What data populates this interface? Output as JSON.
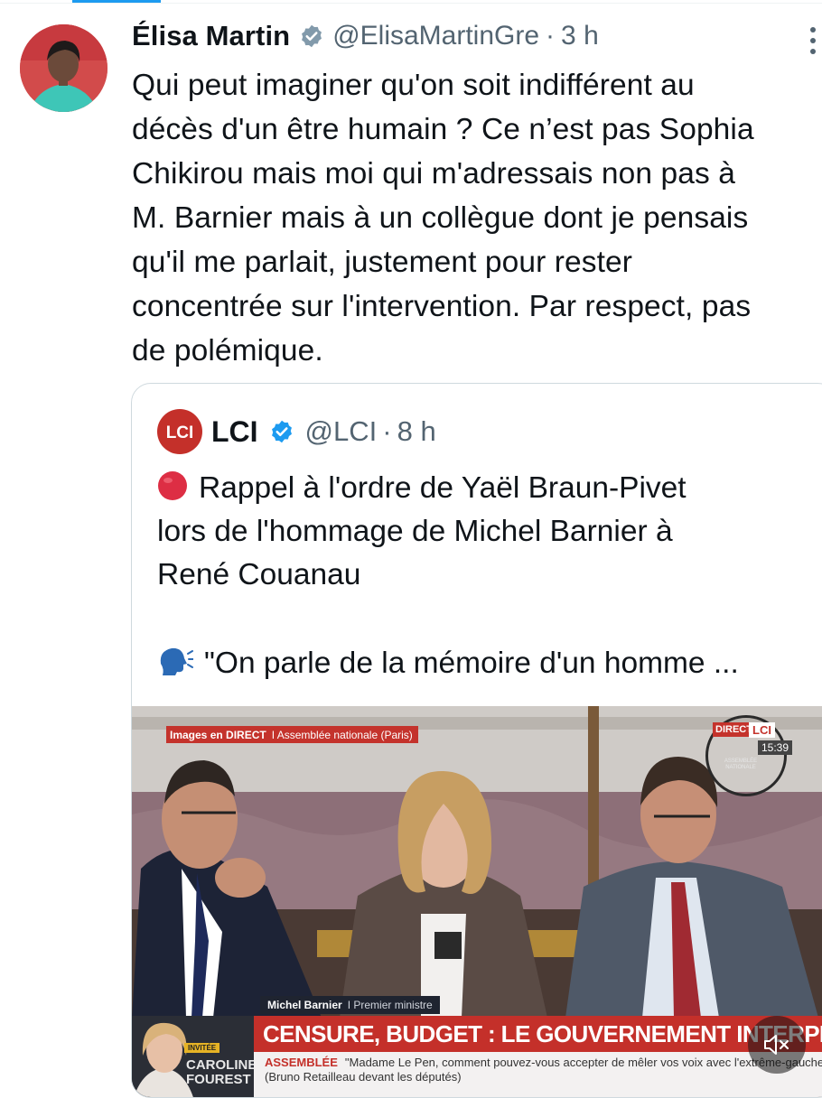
{
  "tweet": {
    "author_name": "Élisa Martin",
    "handle": "@ElisaMartinGre",
    "separator": "·",
    "time": "3 h",
    "text": "Qui peut imaginer qu'on soit indifférent au\ndécès d'un être humain ? Ce n’est pas Sophia\nChikirou mais moi qui m'adressais non pas à\nM. Barnier mais à un collègue dont je pensais\nqu'il me parlait, justement pour rester\nconcentrée sur l'intervention. Par respect, pas\nde polémique."
  },
  "quote": {
    "author_name": "LCI",
    "handle": "@LCI",
    "separator": "·",
    "time": "8 h",
    "line1": "Rappel à l'ordre de Yaël Braun-Pivet",
    "line2": "lors de l'hommage de Michel Barnier à",
    "line3": "René Couanau",
    "line4": "\"On parle de la mémoire d'un homme ...",
    "emoji1": "red-circle",
    "emoji2": "speaking-head"
  },
  "video": {
    "direct_tag_bold": "Images en DIRECT",
    "direct_tag_place": "I  Assemblée nationale (Paris)",
    "bug_direct": "DIRECT",
    "bug_lci": "LCI",
    "bug_time": "15:39",
    "bug_assembly": "ASSEMBLÉE NATIONALE",
    "lower_name": "Michel Barnier",
    "lower_role": "I  Premier ministre",
    "banner": "CENSURE, BUDGET : LE GOUVERNEMENT INTERPELLÉ",
    "ticker_tag": "ASSEMBLÉE",
    "ticker_text": "\"Madame Le Pen, comment pouvez-vous accepter de mêler vos voix avec l'extrême-gauche\" (Bruno Retailleau devant les députés)",
    "guest_label": "INVITÉE",
    "guest_name": "CAROLINE FOUREST"
  },
  "colors": {
    "accent": "#1d9bf0",
    "lci_red": "#c4302a"
  }
}
